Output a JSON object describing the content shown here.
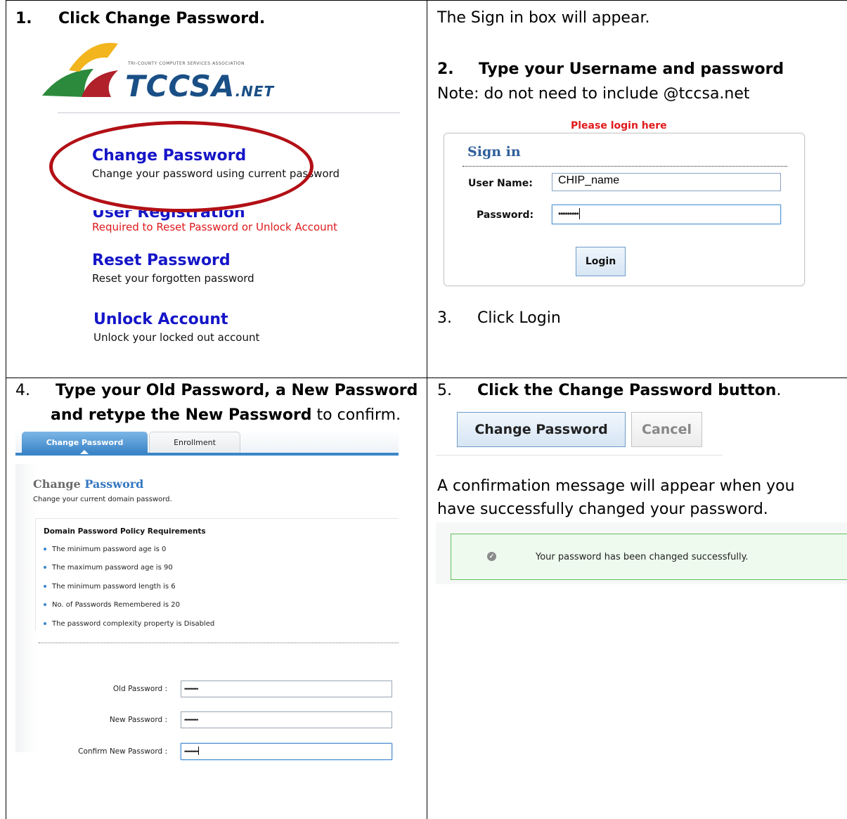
{
  "step1": {
    "heading_num": "1.",
    "heading": "Click Change Password.",
    "logo_text": "TCCSA",
    "logo_suffix": ".NET",
    "logo_tagline": "TRI-COUNTY COMPUTER SERVICES ASSOCIATION",
    "menu": [
      {
        "title": "Change Password",
        "desc": "Change your password using current password"
      },
      {
        "title": "User Registration",
        "desc": "Required to Reset Password or Unlock Account"
      },
      {
        "title": "Reset Password",
        "desc": "Reset your forgotten password"
      },
      {
        "title": "Unlock Account",
        "desc": "Unlock your locked out account"
      }
    ]
  },
  "step2": {
    "intro": "The Sign in box will appear.",
    "heading_num": "2.",
    "heading": "Type your Username and password",
    "note": "Note: do not need to include @tccsa.net",
    "please_login": "Please login here",
    "signin_title": "Sign in",
    "username_label": "User Name:",
    "username_value": "CHIP_name",
    "password_label": "Password:",
    "password_value": "•••••••••",
    "login_button": "Login"
  },
  "step3": {
    "num": "3.",
    "text": "Click Login"
  },
  "step4": {
    "num": "4.",
    "bold_text_line1": "Type your Old Password, a New Password",
    "bold_text_line2": "and retype the New Password",
    "plain_text": " to confirm.",
    "tabs": [
      "Change Password",
      "Enrollment"
    ],
    "title_word1": "Change",
    "title_word2": "Password",
    "subtitle": "Change your current domain password.",
    "policy_heading": "Domain Password Policy Requirements",
    "policies": [
      "The minimum password age is 0",
      "The maximum password age is 90",
      "The minimum password length is 6",
      "No. of Passwords Remembered is 20",
      "The password complexity property is Disabled"
    ],
    "old_label": "Old Password :",
    "new_label": "New Password :",
    "confirm_label": "Confirm New Password :",
    "old_value": "•••••••••",
    "new_value": "•••••••••",
    "confirm_value": "•••••••••"
  },
  "step5": {
    "num": "5.",
    "bold_text": "Click the Change Password button",
    "period": ".",
    "change_button": "Change Password",
    "cancel_button": "Cancel",
    "confirm_line1": "A confirmation message will appear when you",
    "confirm_line2": "have successfully changed your password.",
    "success_message": "Your password has been changed successfully."
  },
  "colors": {
    "menu_link": "#1515c8",
    "warning_red": "#e0191b",
    "ellipse": "#b21016",
    "tab_blue": "#3a86c8",
    "success_border": "#61c05e"
  }
}
